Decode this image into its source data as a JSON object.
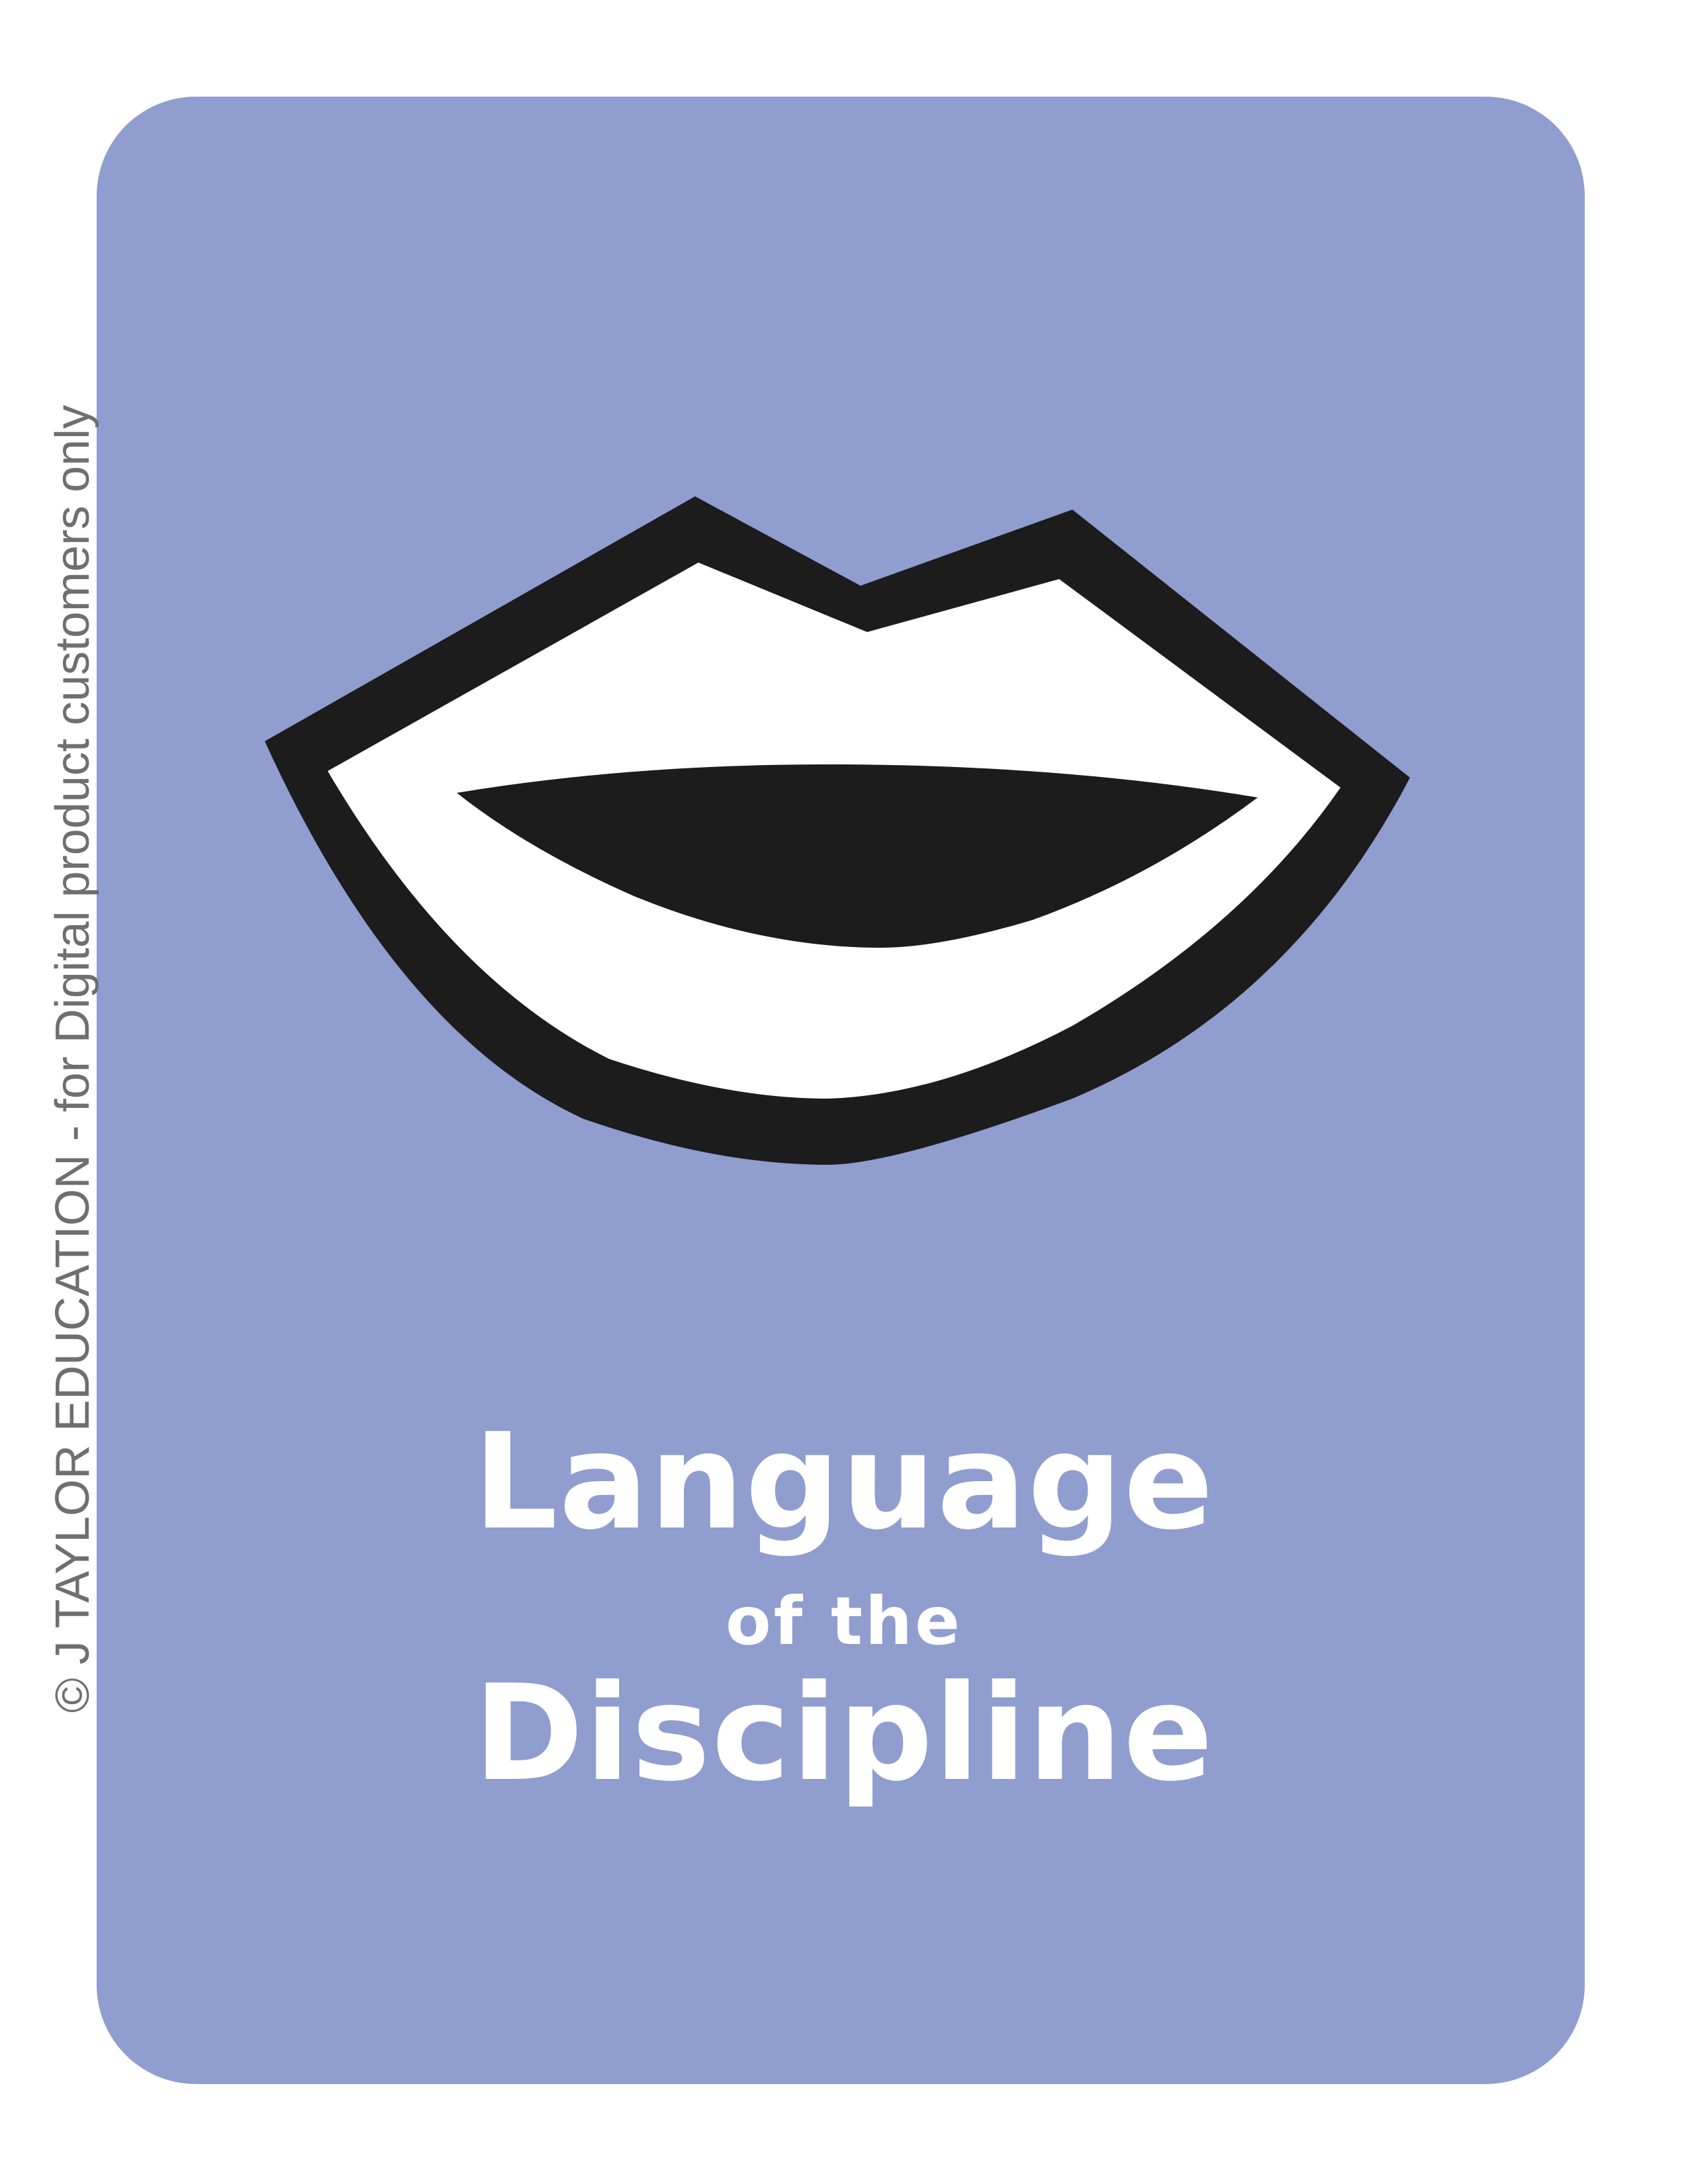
{
  "card": {
    "background_color": "#8f9dcf",
    "illustration": "open-mouth-lips-icon"
  },
  "title": {
    "line1": "Language",
    "line2": "of the",
    "line3": "Discipline"
  },
  "copyright": "© J TAYLOR EDUCATION - for Digital product customers only"
}
